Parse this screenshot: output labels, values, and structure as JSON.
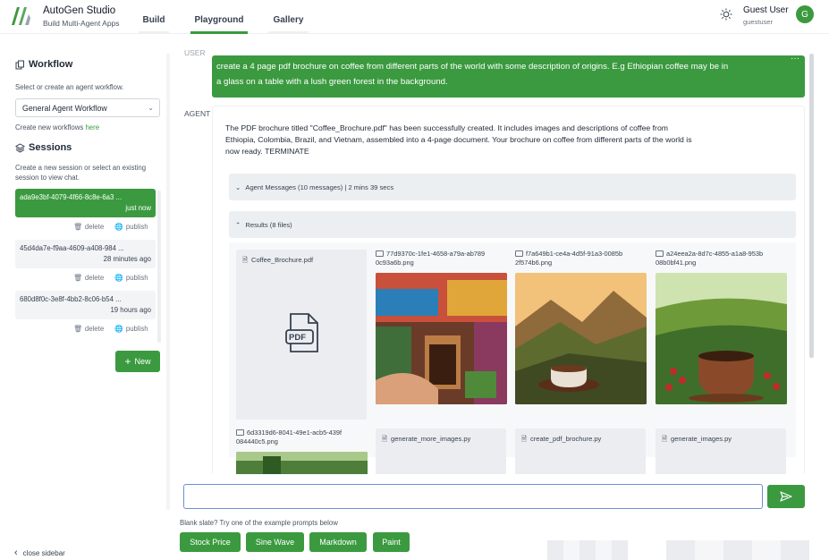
{
  "app": {
    "title": "AutoGen Studio",
    "subtitle": "Build Multi-Agent Apps"
  },
  "nav": {
    "tabs": [
      {
        "label": "Build",
        "active": false
      },
      {
        "label": "Playground",
        "active": true
      },
      {
        "label": "Gallery",
        "active": false
      }
    ]
  },
  "user": {
    "name": "Guest User",
    "email": "guestuser",
    "initial": "G"
  },
  "sidebar": {
    "workflow_heading": "Workflow",
    "workflow_desc": "Select or create an agent workflow.",
    "workflow_selected": "General Agent Workflow",
    "create_workflows_text": "Create new workflows",
    "create_workflows_link": "here",
    "sessions_heading": "Sessions",
    "sessions_desc_1": "Create a new session or select an existing",
    "sessions_desc_2": "session to view chat.",
    "sessions": [
      {
        "id": "ada9e3bf-4079-4f66-8c8e-6a3 ...",
        "time": "just now",
        "active": true
      },
      {
        "id": "45d4da7e-f9aa-4609-a408-984 ...",
        "time": "28 minutes ago",
        "active": false
      },
      {
        "id": "680d8f0c-3e8f-4bb2-8c06-b54 ...",
        "time": "19 hours ago",
        "active": false
      }
    ],
    "delete_label": "delete",
    "publish_label": "publish",
    "new_button": "New",
    "close_sidebar": "close sidebar"
  },
  "chat": {
    "user_label": "USER",
    "user_message_line1": "create a 4 page pdf brochure on coffee from different parts of the world with some description of origins. E.g Ethiopian coffee may be in",
    "user_message_line2": "a glass on a table with a lush green forest in the background.",
    "agent_label": "AGENT",
    "agent_line1": "The PDF brochure titled \"Coffee_Brochure.pdf\" has been successfully created. It includes images and descriptions of coffee from",
    "agent_line2": "Ethiopia, Colombia, Brazil, and Vietnam, assembled into a 4-page document. Your brochure on coffee from different parts of the world is",
    "agent_line3": "now ready. TERMINATE",
    "agent_messages_accordion": "Agent Messages (10 messages) | 2 mins 39 secs",
    "results_accordion": "Results (8 files)",
    "pdf_file": "Coffee_Brochure.pdf",
    "pdf_badge": "PDF",
    "images": [
      {
        "name_line1": "77d9370c-1fe1-4658-a79a-ab789",
        "name_line2": "0c93a6b.png"
      },
      {
        "name_line1": "f7a649b1-ce4a-4d5f-91a3-0085b",
        "name_line2": "2f574b6.png"
      },
      {
        "name_line1": "a24eea2a-8d7c-4855-a1a8-953b",
        "name_line2": "08b0bf41.png"
      },
      {
        "name_line1": "6d3319d6-8041-49e1-acb5-439f",
        "name_line2": "084440c5.png"
      }
    ],
    "py_files": [
      "generate_more_images.py",
      "create_pdf_brochure.py",
      "generate_images.py"
    ]
  },
  "input": {
    "value": "",
    "placeholder": "",
    "hint": "Blank slate? Try one of the example prompts below",
    "prompts": [
      "Stock Price",
      "Sine Wave",
      "Markdown",
      "Paint"
    ]
  },
  "colors": {
    "accent": "#3b9a3f"
  }
}
